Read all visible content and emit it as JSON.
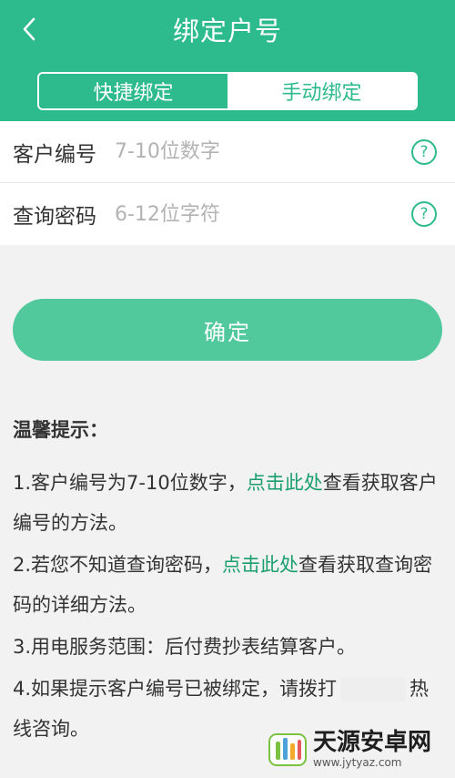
{
  "header": {
    "title": "绑定户号",
    "tabs": [
      {
        "label": "快捷绑定",
        "active": false
      },
      {
        "label": "手动绑定",
        "active": true
      }
    ]
  },
  "form": {
    "customer_id": {
      "label": "客户编号",
      "placeholder": "7-10位数字"
    },
    "query_password": {
      "label": "查询密码",
      "placeholder": "6-12位字符"
    },
    "help_icon": "?"
  },
  "confirm_label": "确定",
  "tips": {
    "title": "温馨提示：",
    "items": [
      {
        "prefix": "1.客户编号为7-10位数字，",
        "link": "点击此处",
        "suffix": "查看获取客户编号的方法。"
      },
      {
        "prefix": "2.若您不知道查询密码，",
        "link": "点击此处",
        "suffix": "查看获取查询密码的详细方法。"
      },
      {
        "text": "3.用电服务范围：后付费抄表结算客户。"
      },
      {
        "prefix": "4.如果提示客户编号已被绑定，请拨打",
        "suffix": "热线咨询。"
      }
    ]
  },
  "watermark": {
    "name": "天源安卓网",
    "url": "www.jytyaz.com"
  },
  "colors": {
    "brand": "#2dba8c",
    "button": "#52c99d",
    "link": "#1a9e6e"
  },
  "icons": {
    "back": "chevron-left-icon",
    "help": "question-circle-icon"
  }
}
